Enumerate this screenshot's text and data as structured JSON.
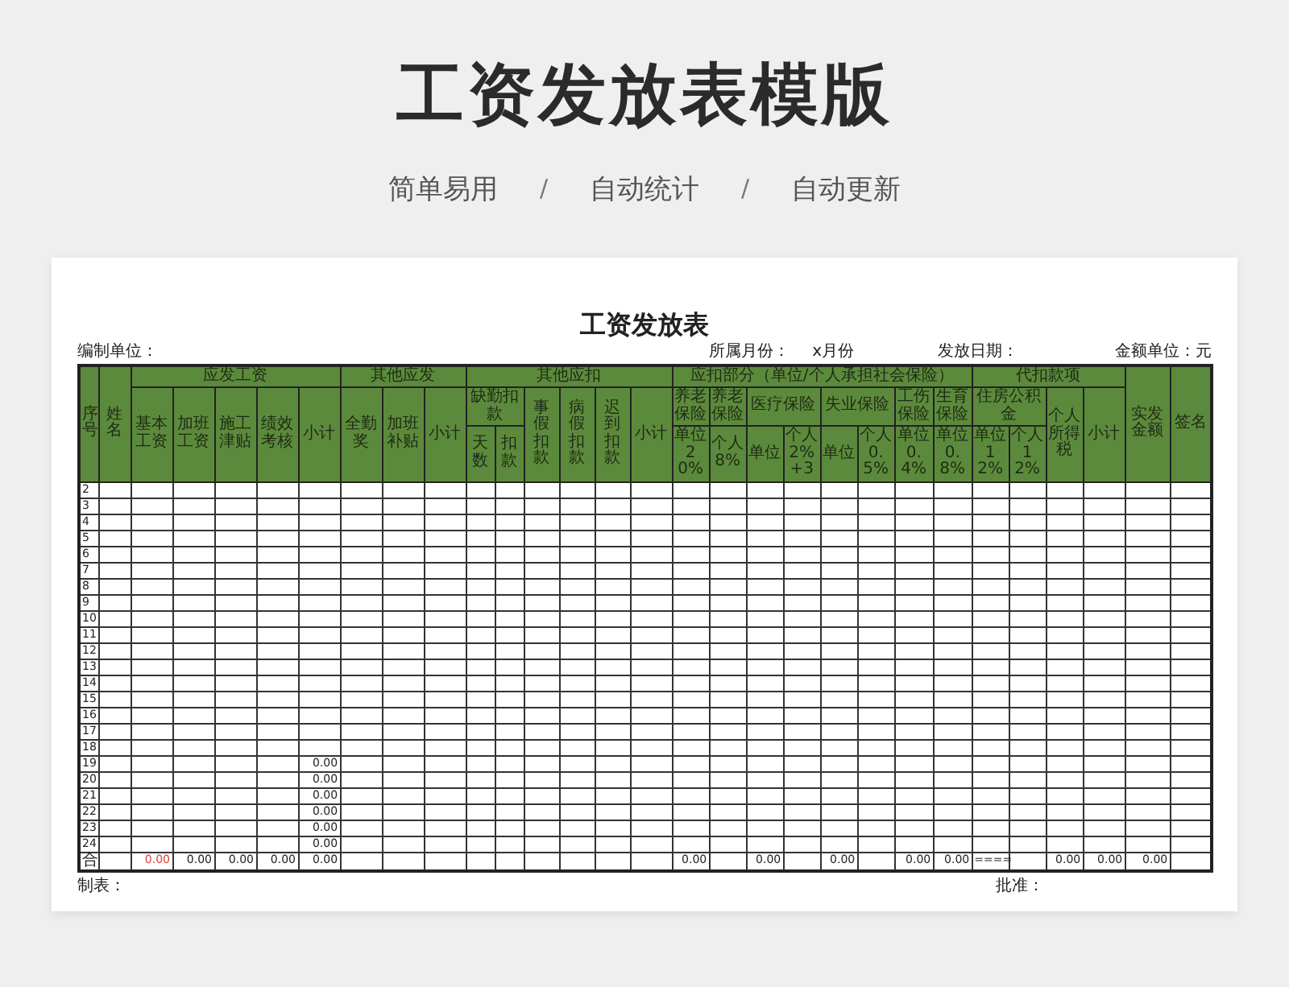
{
  "page_title": "工资发放表模版",
  "tagline": [
    {
      "kind": "text",
      "text": "简单易用"
    },
    {
      "kind": "separator",
      "text": "/"
    },
    {
      "kind": "text",
      "text": "自动统计"
    },
    {
      "kind": "separator",
      "text": "/"
    },
    {
      "kind": "text",
      "text": "自动更新"
    }
  ],
  "sheet": {
    "title": "工资发放表",
    "meta": [
      {
        "label": "编制单位："
      },
      {
        "label": "所属月份："
      },
      {
        "label": "x月份"
      },
      {
        "label": "发放日期："
      },
      {
        "label": "金额单位：元"
      }
    ],
    "columns": [
      {
        "label": "序号"
      },
      {
        "label": "姓名"
      },
      {
        "label": "应发工资",
        "children": [
          {
            "label": "基本工资"
          },
          {
            "label": "加班工资"
          },
          {
            "label": "施工津贴"
          },
          {
            "label": "绩效考核"
          },
          {
            "label": "小计"
          }
        ]
      },
      {
        "label": "其他应发",
        "children": [
          {
            "label": "全勤奖"
          },
          {
            "label": "加班补贴"
          },
          {
            "label": "小计"
          }
        ]
      },
      {
        "label": "其他应扣",
        "children": [
          {
            "label": "缺勤扣款",
            "children": [
              {
                "label": "天数"
              },
              {
                "label": "扣款"
              }
            ]
          },
          {
            "label": "事假扣款"
          },
          {
            "label": "病假扣款"
          },
          {
            "label": "迟到扣款"
          },
          {
            "label": "小计"
          }
        ]
      },
      {
        "label": "应扣部分（单位/个人承担社会保险）",
        "children": [
          {
            "label": "养老保险",
            "children": [
              {
                "label": "单位20%"
              }
            ]
          },
          {
            "label": "养老保险",
            "children": [
              {
                "label": "个人8%"
              }
            ]
          },
          {
            "label": "医疗保险",
            "children": [
              {
                "label": "单位"
              },
              {
                "label": "个人2%+3"
              }
            ]
          },
          {
            "label": "失业保险",
            "children": [
              {
                "label": "单位"
              },
              {
                "label": "个人0.5%"
              }
            ]
          },
          {
            "label": "工伤保险",
            "children": [
              {
                "label": "单位0.4%"
              }
            ]
          },
          {
            "label": "生育保险",
            "children": [
              {
                "label": "单位0.8%"
              }
            ]
          }
        ]
      },
      {
        "label": "代扣款项",
        "children": [
          {
            "label": "住房公积金",
            "children": [
              {
                "label": "单位12%"
              },
              {
                "label": "个人12%"
              }
            ]
          },
          {
            "label": "个人所得税"
          },
          {
            "label": "小计"
          }
        ]
      },
      {
        "label": "实发金额"
      },
      {
        "label": "签名"
      }
    ],
    "rows": [
      {
        "no": "2"
      },
      {
        "no": "3"
      },
      {
        "no": "4"
      },
      {
        "no": "5"
      },
      {
        "no": "6"
      },
      {
        "no": "7"
      },
      {
        "no": "8"
      },
      {
        "no": "9"
      },
      {
        "no": "10"
      },
      {
        "no": "11"
      },
      {
        "no": "12"
      },
      {
        "no": "13"
      },
      {
        "no": "14"
      },
      {
        "no": "15"
      },
      {
        "no": "16"
      },
      {
        "no": "17"
      },
      {
        "no": "18"
      },
      {
        "no": "19",
        "cells": [
          {
            "kind": "wagesum",
            "text": "0.00"
          }
        ]
      },
      {
        "no": "20",
        "cells": [
          {
            "kind": "wagesum",
            "text": "0.00"
          }
        ]
      },
      {
        "no": "21",
        "cells": [
          {
            "kind": "wagesum",
            "text": "0.00"
          }
        ]
      },
      {
        "no": "22",
        "cells": [
          {
            "kind": "wagesum",
            "text": "0.00"
          }
        ]
      },
      {
        "no": "23",
        "cells": [
          {
            "kind": "wagesum",
            "text": "0.00"
          }
        ]
      },
      {
        "no": "24",
        "cells": [
          {
            "kind": "wagesum",
            "text": "0.00"
          }
        ]
      }
    ],
    "total_row": {
      "label": "合",
      "cells": [
        {
          "kind": "basic",
          "text": "0.00",
          "color": "#e0403a"
        },
        {
          "kind": "overtime",
          "text": "0.00"
        },
        {
          "kind": "allowance",
          "text": "0.00"
        },
        {
          "kind": "performance",
          "text": "0.00"
        },
        {
          "kind": "wagesum",
          "text": "0.00"
        },
        {
          "kind": "pension",
          "text": "0.00"
        },
        {
          "kind": "medical",
          "text": "0.00"
        },
        {
          "kind": "unemployment",
          "text": "0.00"
        },
        {
          "kind": "injury",
          "text": "0.00"
        },
        {
          "kind": "maternity",
          "text": "0.00"
        },
        {
          "kind": "housingfund",
          "text": "===="
        },
        {
          "kind": "incometax",
          "text": "0.00"
        },
        {
          "kind": "withholdingsum",
          "text": "0.00"
        },
        {
          "kind": "netpay",
          "text": "0.00"
        }
      ]
    },
    "footer": [
      {
        "label": "制表："
      },
      {
        "label": "批准："
      }
    ]
  }
}
